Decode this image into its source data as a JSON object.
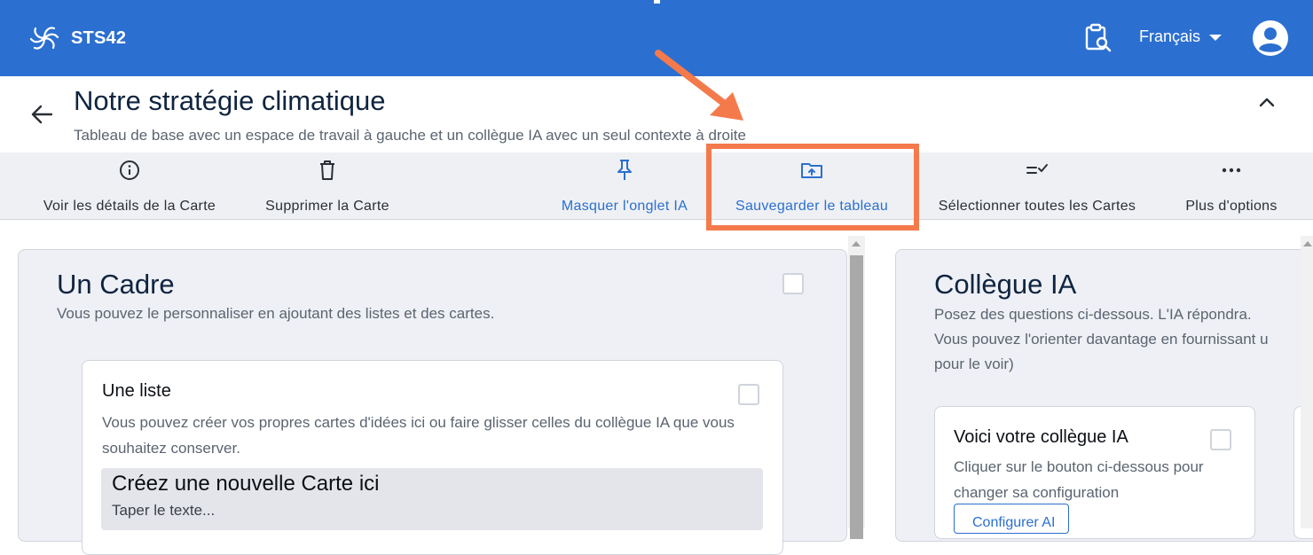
{
  "app": {
    "name": "STS42",
    "language": "Français",
    "icons": {
      "logo": "spiral-logo-icon",
      "search": "clipboard-search-icon",
      "avatar": "account-circle-icon"
    }
  },
  "page": {
    "title": "Notre stratégie climatique",
    "subtitle": "Tableau de base avec un espace de travail à gauche et un collègue IA avec un seul contexte à droite"
  },
  "toolbar": {
    "items": [
      {
        "label": "Voir les détails de la Carte",
        "icon": "info-icon"
      },
      {
        "label": "Supprimer la Carte",
        "icon": "trash-icon"
      },
      {
        "label": "Masquer l'onglet IA",
        "icon": "pin-icon"
      },
      {
        "label": "Sauvegarder le tableau",
        "icon": "folder-upload-icon"
      },
      {
        "label": "Sélectionner toutes les Cartes",
        "icon": "select-all-icon"
      },
      {
        "label": "Plus d'options",
        "icon": "more-horizontal-icon"
      }
    ]
  },
  "frame": {
    "title": "Un Cadre",
    "description": "Vous pouvez le personnaliser en ajoutant des listes et des cartes.",
    "list": {
      "title": "Une liste",
      "description": "Vous pouvez créer vos propres cartes d'idées ici ou faire glisser celles du collègue IA que vous souhaitez conserver.",
      "new_card_title": "Créez une nouvelle Carte ici",
      "new_card_placeholder": "Taper le texte..."
    }
  },
  "ai": {
    "title": "Collègue IA",
    "description": "Posez des questions ci-dessous. L'IA répondra.\nVous pouvez l'orienter davantage en fournissant u\npour le voir)",
    "card_title": "Voici votre collègue IA",
    "card_description": "Cliquer sur le bouton ci-dessous pour changer sa configuration",
    "button_label": "Configurer AI"
  },
  "colors": {
    "brand": "#2b6fd0",
    "highlight": "#f47a4c"
  }
}
